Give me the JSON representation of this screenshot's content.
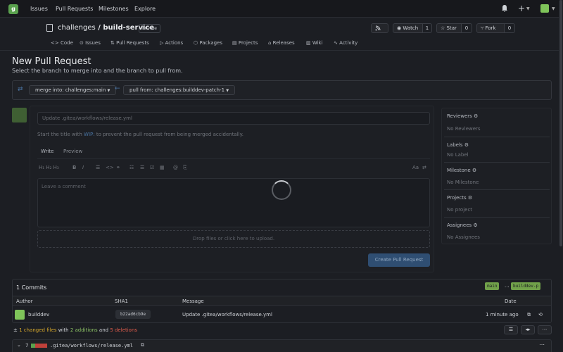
{
  "nav": {
    "logo": "g",
    "links": [
      "Issues",
      "Pull Requests",
      "Milestones",
      "Explore"
    ],
    "plus": "+"
  },
  "repo": {
    "owner": "challenges",
    "separator": " / ",
    "name": "build-service",
    "visibility": "Private",
    "watch_label": "Watch",
    "watch_count": "1",
    "star_label": "Star",
    "star_count": "0",
    "fork_label": "Fork",
    "fork_count": "0"
  },
  "tabs": [
    "Code",
    "Issues",
    "Pull Requests",
    "Actions",
    "Packages",
    "Projects",
    "Releases",
    "Wiki",
    "Activity"
  ],
  "page": {
    "title": "New Pull Request",
    "subtitle": "Select the branch to merge into and the branch to pull from."
  },
  "branches": {
    "base": "merge into: challenges:main",
    "head": "pull from: challenges:builddev-patch-1",
    "arrow": "←"
  },
  "form": {
    "title_value": "Update .gitea/workflows/release.yml",
    "wip_prefix": "Start the title with ",
    "wip_keyword": "WIP:",
    "wip_suffix": " to prevent the pull request from being merged accidentally.",
    "tab_write": "Write",
    "tab_preview": "Preview",
    "toolbar_headings": "H₁ H₂ H₃",
    "toolbar_bold": "B",
    "toolbar_italic": "I",
    "toolbar_font": "Aa",
    "textarea_placeholder": "Leave a comment",
    "drop_text": "Drop files or click here to upload.",
    "submit_label": "Create Pull Request"
  },
  "sidebar": {
    "reviewers_label": "Reviewers",
    "reviewers_value": "No Reviewers",
    "labels_label": "Labels",
    "labels_value": "No Label",
    "milestone_label": "Milestone",
    "milestone_value": "No Milestone",
    "projects_label": "Projects",
    "projects_value": "No project",
    "assignees_label": "Assignees",
    "assignees_value": "No Assignees"
  },
  "commits": {
    "heading": "1 Commits",
    "base_tag": "main",
    "dots": "...",
    "head_tag": "builddev-p",
    "columns": [
      "Author",
      "SHA1",
      "Message",
      "Date"
    ],
    "rows": [
      {
        "author": "builddev",
        "sha": "b22ad6cb9e",
        "message": "Update .gitea/workflows/release.yml",
        "date": "1 minute ago"
      }
    ]
  },
  "diff": {
    "changed_files": "1 changed files",
    "with": " with ",
    "additions": "2 additions",
    "and": " and ",
    "deletions": "5 deletions",
    "file_count": "7",
    "file_name": ".gitea/workflows/release.yml",
    "more": "⋯"
  },
  "colors": {
    "accent": "#4b76a6",
    "tag_green": "#71a14a",
    "addition": "#8cc265",
    "deletion": "#e05d4c"
  }
}
